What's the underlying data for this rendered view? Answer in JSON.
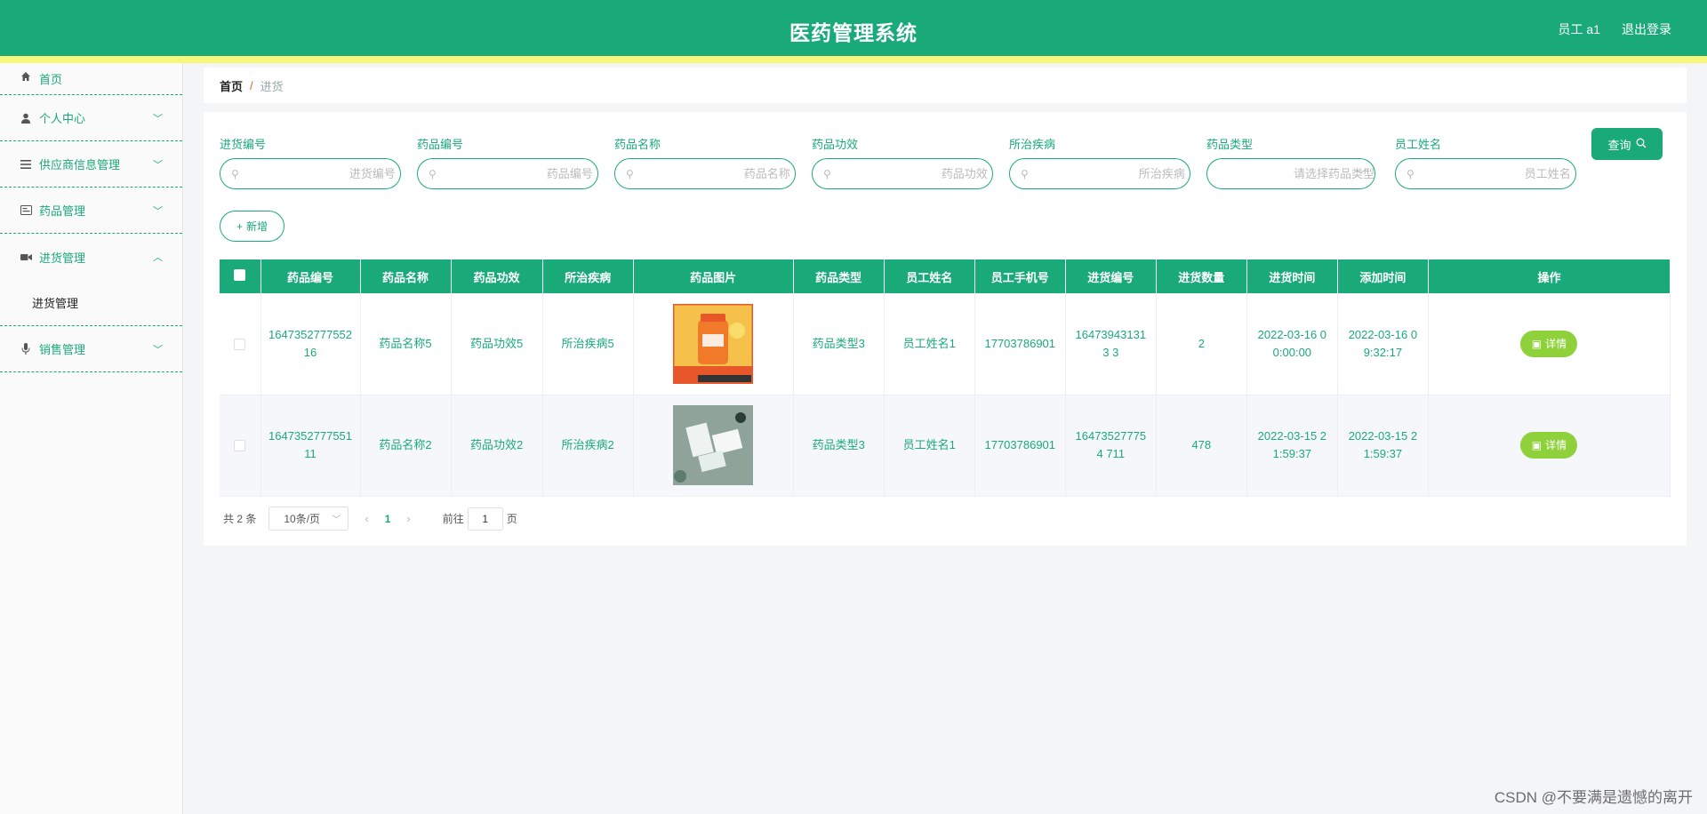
{
  "header": {
    "title": "医药管理系统",
    "user": "员工 a1",
    "logout": "退出登录",
    "colors": {
      "primary": "#1aaa79",
      "stripe": "#f7f77a"
    }
  },
  "sidebar": {
    "items": [
      {
        "label": "首页",
        "icon": "home-icon"
      },
      {
        "label": "个人中心",
        "icon": "user-icon"
      },
      {
        "label": "供应商信息管理",
        "icon": "list-icon"
      },
      {
        "label": "药品管理",
        "icon": "card-icon"
      },
      {
        "label": "进货管理",
        "icon": "video-icon",
        "sub": "进货管理"
      },
      {
        "label": "销售管理",
        "icon": "mic-icon"
      }
    ]
  },
  "breadcrumb": {
    "home": "首页",
    "separator": "/",
    "current": "进货"
  },
  "filters": [
    {
      "label": "进货编号",
      "placeholder": "进货编号"
    },
    {
      "label": "药品编号",
      "placeholder": "药品编号"
    },
    {
      "label": "药品名称",
      "placeholder": "药品名称"
    },
    {
      "label": "药品功效",
      "placeholder": "药品功效"
    },
    {
      "label": "所治疾病",
      "placeholder": "所治疾病"
    },
    {
      "label": "药品类型",
      "placeholder": "请选择药品类型"
    },
    {
      "label": "员工姓名",
      "placeholder": "员工姓名"
    }
  ],
  "buttons": {
    "query": "查询",
    "add": "新增",
    "detail": "详情"
  },
  "table": {
    "columns": [
      "药品编号",
      "药品名称",
      "药品功效",
      "所治疾病",
      "药品图片",
      "药品类型",
      "员工姓名",
      "员工手机号",
      "进货编号",
      "进货数量",
      "进货时间",
      "添加时间",
      "操作"
    ],
    "rows": [
      {
        "drug_no": "1647352777552 16",
        "name": "药品名称5",
        "effect": "药品功效5",
        "disease": "所治疾病5",
        "image": "orange-supplement-bottle",
        "type": "药品类型3",
        "employee": "员工姓名1",
        "phone": "17703786901",
        "purchase_no": "164739431313 3",
        "qty": "2",
        "purchase_time": "2022-03-16 00:00:00",
        "added_time": "2022-03-16 09:32:17"
      },
      {
        "drug_no": "1647352777551 11",
        "name": "药品名称2",
        "effect": "药品功效2",
        "disease": "所治疾病2",
        "image": "green-cards-mockup",
        "type": "药品类型3",
        "employee": "员工姓名1",
        "phone": "17703786901",
        "purchase_no": "164735277754 711",
        "qty": "478",
        "purchase_time": "2022-03-15 21:59:37",
        "added_time": "2022-03-15 21:59:37"
      }
    ]
  },
  "pagination": {
    "total": "共 2 条",
    "page_size": "10条/页",
    "current_page": "1",
    "goto_label": "前往",
    "goto_value": "1",
    "page_suffix": "页"
  },
  "watermark": "CSDN @不要满是遗憾的离开"
}
